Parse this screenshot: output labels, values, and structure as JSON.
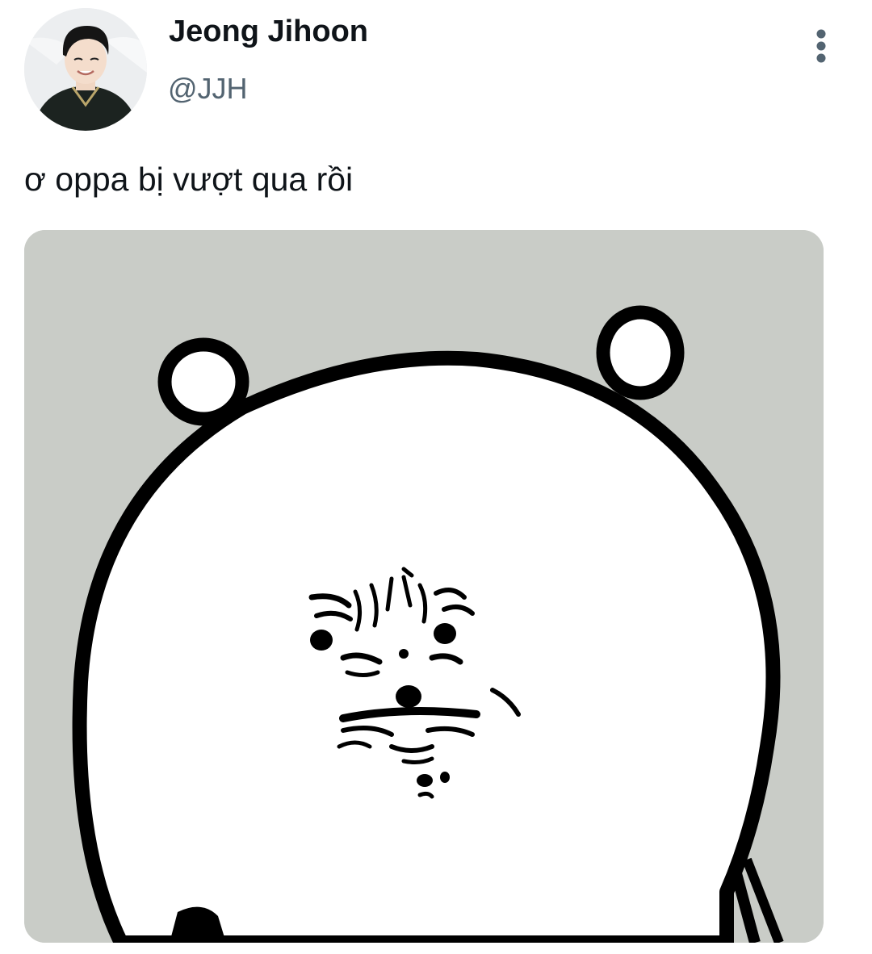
{
  "tweet": {
    "author": {
      "display_name": "Jeong Jihoon",
      "handle": "@JJH",
      "avatar_icon": "profile-photo"
    },
    "text": "ơ oppa bị vượt qua rồi",
    "more_icon": "more-vertical-icon",
    "media": {
      "kind": "image",
      "subject": "meme-bear-drawing"
    }
  },
  "colors": {
    "text_primary": "#0f1419",
    "text_secondary": "#536471",
    "icon_gray": "#536471",
    "media_background": "#c9ccc7",
    "drawing_ink": "#000000",
    "drawing_fill": "#ffffff"
  }
}
